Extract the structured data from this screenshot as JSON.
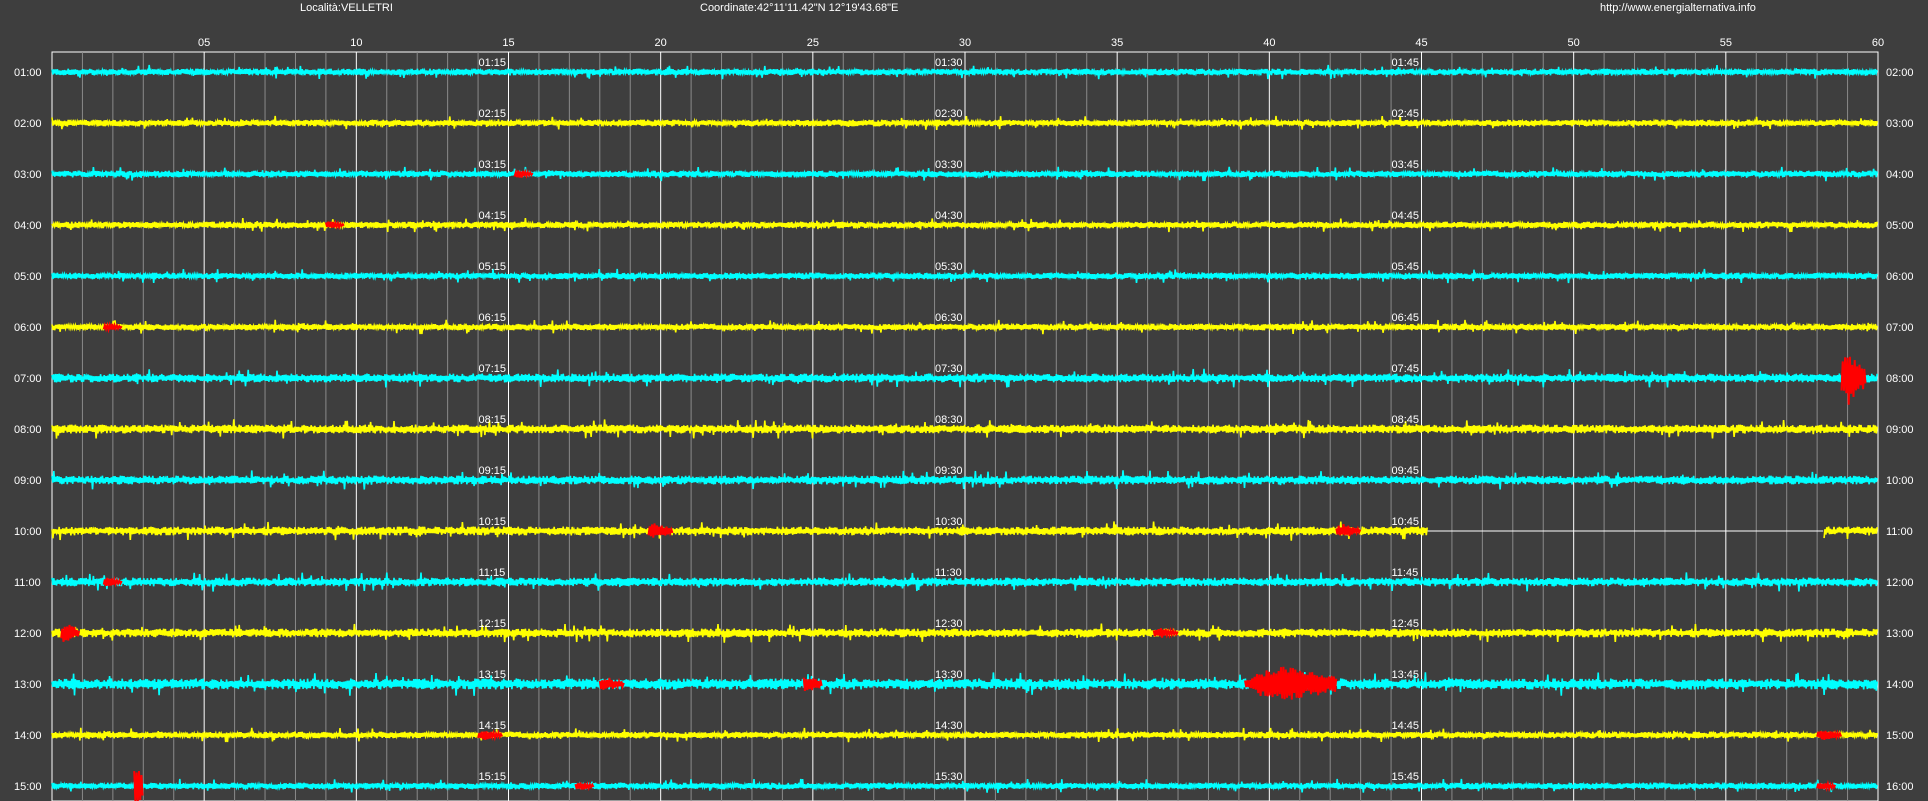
{
  "header": {
    "location": "Località:VELLETRI",
    "coordinates": "Coordinate:42°11'11.42\"N  12°19'43.68\"E",
    "website": "http://www.energialternativa.info"
  },
  "colors": {
    "background": "#3e3e3e",
    "grid_major": "#ffffff",
    "grid_minor": "#8a8a8a",
    "trace_a": "#00ffff",
    "trace_b": "#ffff00",
    "event": "#ff0000"
  },
  "chart_data": {
    "type": "line",
    "subtype": "helicorder",
    "x_axis": {
      "range": [
        0,
        60
      ],
      "tick_labels": [
        "05",
        "10",
        "15",
        "20",
        "25",
        "30",
        "35",
        "40",
        "45",
        "50",
        "55",
        "60"
      ],
      "tick_values": [
        5,
        10,
        15,
        20,
        25,
        30,
        35,
        40,
        45,
        50,
        55,
        60
      ],
      "minor_grid_step": 1
    },
    "rows": [
      {
        "start": "01:00",
        "end": "02:00",
        "quarters": [
          "01:15",
          "01:30",
          "01:45"
        ],
        "color": "cyan",
        "amp": 3,
        "events": [],
        "data_gap": null
      },
      {
        "start": "02:00",
        "end": "03:00",
        "quarters": [
          "02:15",
          "02:30",
          "02:45"
        ],
        "color": "yellow",
        "amp": 3,
        "events": [],
        "data_gap": null
      },
      {
        "start": "03:00",
        "end": "04:00",
        "quarters": [
          "03:15",
          "03:30",
          "03:45"
        ],
        "color": "cyan",
        "amp": 3,
        "events": [
          {
            "minute": 15.2,
            "amp": 4,
            "duration": 0.6
          }
        ],
        "data_gap": null
      },
      {
        "start": "04:00",
        "end": "05:00",
        "quarters": [
          "04:15",
          "04:30",
          "04:45"
        ],
        "color": "yellow",
        "amp": 3,
        "events": [
          {
            "minute": 9.0,
            "amp": 4,
            "duration": 0.6
          }
        ],
        "data_gap": null
      },
      {
        "start": "05:00",
        "end": "06:00",
        "quarters": [
          "05:15",
          "05:30",
          "05:45"
        ],
        "color": "cyan",
        "amp": 3,
        "events": [],
        "data_gap": null
      },
      {
        "start": "06:00",
        "end": "07:00",
        "quarters": [
          "06:15",
          "06:30",
          "06:45"
        ],
        "color": "yellow",
        "amp": 3,
        "events": [
          {
            "minute": 1.7,
            "amp": 4,
            "duration": 0.6
          }
        ],
        "data_gap": null
      },
      {
        "start": "07:00",
        "end": "08:00",
        "quarters": [
          "07:15",
          "07:30",
          "07:45"
        ],
        "color": "cyan",
        "amp": 4,
        "events": [
          {
            "minute": 58.8,
            "amp": 28,
            "duration": 0.8
          }
        ],
        "data_gap": null
      },
      {
        "start": "08:00",
        "end": "09:00",
        "quarters": [
          "08:15",
          "08:30",
          "08:45"
        ],
        "color": "yellow",
        "amp": 4,
        "events": [],
        "data_gap": null
      },
      {
        "start": "09:00",
        "end": "10:00",
        "quarters": [
          "09:15",
          "09:30",
          "09:45"
        ],
        "color": "cyan",
        "amp": 4,
        "events": [],
        "data_gap": null
      },
      {
        "start": "10:00",
        "end": "11:00",
        "quarters": [
          "10:15",
          "10:30",
          "10:45"
        ],
        "color": "yellow",
        "amp": 4,
        "events": [
          {
            "minute": 19.6,
            "amp": 8,
            "duration": 0.8
          },
          {
            "minute": 42.2,
            "amp": 7,
            "duration": 0.8
          }
        ],
        "data_gap": [
          45.2,
          58.2
        ]
      },
      {
        "start": "11:00",
        "end": "12:00",
        "quarters": [
          "11:15",
          "11:30",
          "11:45"
        ],
        "color": "cyan",
        "amp": 4,
        "events": [
          {
            "minute": 1.7,
            "amp": 5,
            "duration": 0.6
          }
        ],
        "data_gap": null
      },
      {
        "start": "12:00",
        "end": "13:00",
        "quarters": [
          "12:15",
          "12:30",
          "12:45"
        ],
        "color": "yellow",
        "amp": 4,
        "events": [
          {
            "minute": 0.3,
            "amp": 11,
            "duration": 0.6
          },
          {
            "minute": 36.2,
            "amp": 5,
            "duration": 0.8
          }
        ],
        "data_gap": null
      },
      {
        "start": "13:00",
        "end": "14:00",
        "quarters": [
          "13:15",
          "13:30",
          "13:45"
        ],
        "color": "cyan",
        "amp": 5,
        "events": [
          {
            "minute": 18.0,
            "amp": 7,
            "duration": 0.8
          },
          {
            "minute": 24.7,
            "amp": 10,
            "duration": 0.6
          },
          {
            "minute": 39.2,
            "amp": 26,
            "duration": 3.0
          }
        ],
        "data_gap": null
      },
      {
        "start": "14:00",
        "end": "15:00",
        "quarters": [
          "14:15",
          "14:30",
          "14:45"
        ],
        "color": "yellow",
        "amp": 3,
        "events": [
          {
            "minute": 14.0,
            "amp": 5,
            "duration": 0.8
          },
          {
            "minute": 58.0,
            "amp": 5,
            "duration": 0.8
          }
        ],
        "data_gap": null
      },
      {
        "start": "15:00",
        "end": "16:00",
        "quarters": [
          "15:15",
          "15:30",
          "15:45"
        ],
        "color": "cyan",
        "amp": 3,
        "events": [
          {
            "minute": 2.7,
            "amp": 26,
            "duration": 0.3
          },
          {
            "minute": 17.2,
            "amp": 4,
            "duration": 0.6
          },
          {
            "minute": 58.0,
            "amp": 4,
            "duration": 0.6
          }
        ],
        "data_gap": null
      }
    ]
  }
}
